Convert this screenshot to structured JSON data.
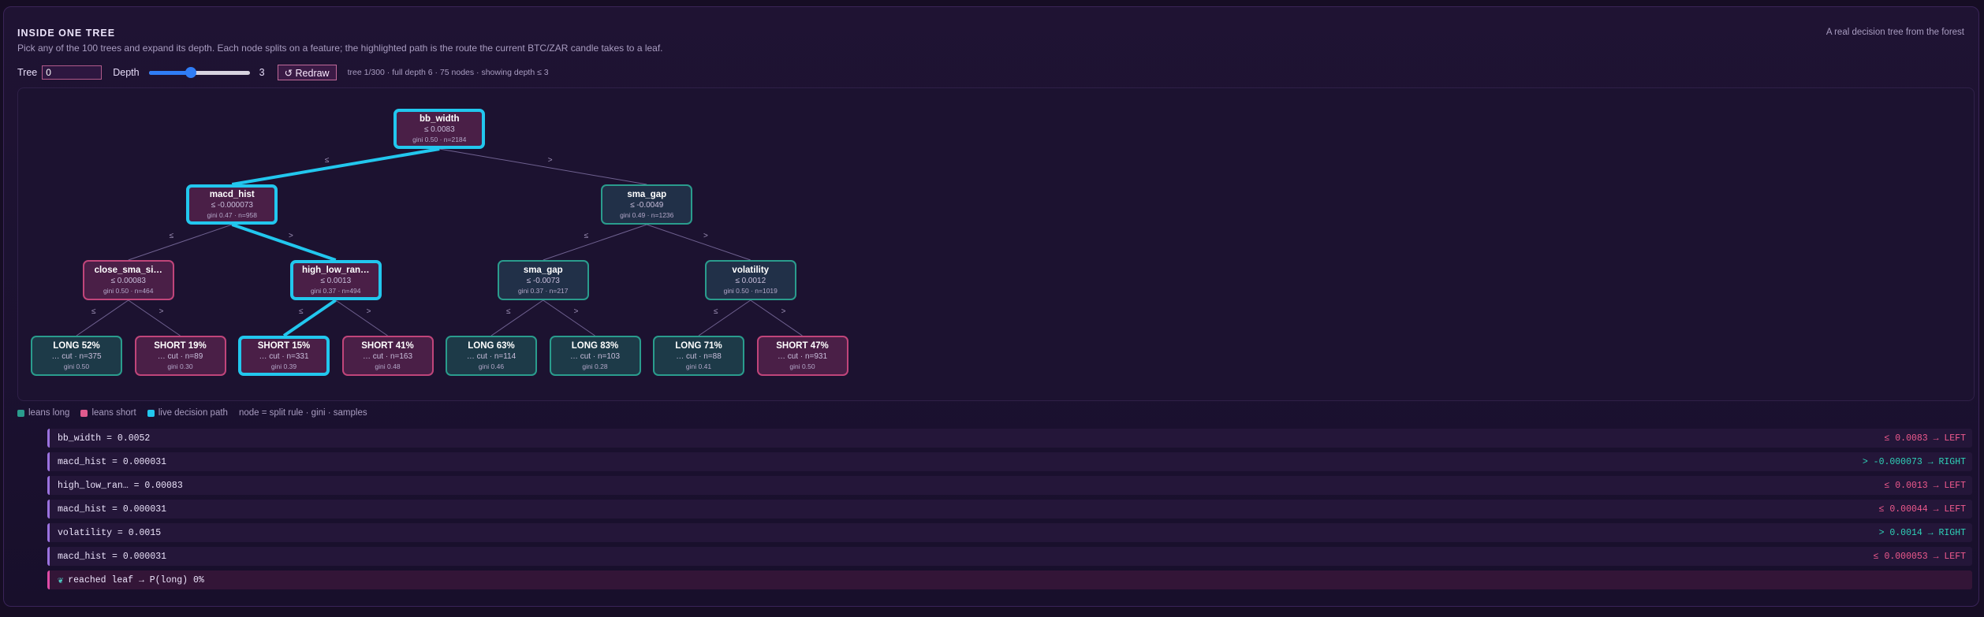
{
  "header": {
    "title": "INSIDE ONE TREE",
    "subtitle": "Pick any of the 100 trees and expand its depth. Each node splits on a feature; the highlighted path is the route the current BTC/ZAR candle takes to a leaf.",
    "right_note": "A real decision tree from the forest"
  },
  "controls": {
    "tree_label": "Tree",
    "tree_value": "0",
    "depth_label": "Depth",
    "depth_value": "3",
    "depth_fraction": 0.42,
    "redraw_label": "↺ Redraw",
    "info": "tree 1/300 · full depth 6 · 75 nodes · showing depth ≤ 3"
  },
  "colors": {
    "long": "#2a9c8d",
    "short": "#c0457a",
    "path": "#22c7ee",
    "edge": "#6f6190"
  },
  "tree": {
    "nodes": [
      {
        "title": "bb_width",
        "rule": "≤ 0.0083",
        "stats": "gini 0.50 · n=2184",
        "lean": "short",
        "path": true
      },
      {
        "title": "macd_hist",
        "rule": "≤ -0.000073",
        "stats": "gini 0.47 · n=958",
        "lean": "short",
        "path": true
      },
      {
        "title": "sma_gap",
        "rule": "≤ -0.0049",
        "stats": "gini 0.49 · n=1236",
        "lean": "long",
        "path": false
      },
      {
        "title": "close_sma_si…",
        "rule": "≤ 0.00083",
        "stats": "gini 0.50 · n=464",
        "lean": "short",
        "path": false
      },
      {
        "title": "high_low_ran…",
        "rule": "≤ 0.0013",
        "stats": "gini 0.37 · n=494",
        "lean": "short",
        "path": true
      },
      {
        "title": "sma_gap",
        "rule": "≤ -0.0073",
        "stats": "gini 0.37 · n=217",
        "lean": "long",
        "path": false
      },
      {
        "title": "volatility",
        "rule": "≤ 0.0012",
        "stats": "gini 0.50 · n=1019",
        "lean": "long",
        "path": false
      },
      {
        "title": "LONG 52%",
        "rule": "… cut · n=375",
        "stats": "gini 0.50",
        "lean": "long",
        "path": false
      },
      {
        "title": "SHORT 19%",
        "rule": "… cut · n=89",
        "stats": "gini 0.30",
        "lean": "short",
        "path": false
      },
      {
        "title": "SHORT 15%",
        "rule": "… cut · n=331",
        "stats": "gini 0.39",
        "lean": "short",
        "path": true
      },
      {
        "title": "SHORT 41%",
        "rule": "… cut · n=163",
        "stats": "gini 0.48",
        "lean": "short",
        "path": false
      },
      {
        "title": "LONG 63%",
        "rule": "… cut · n=114",
        "stats": "gini 0.46",
        "lean": "long",
        "path": false
      },
      {
        "title": "LONG 83%",
        "rule": "… cut · n=103",
        "stats": "gini 0.28",
        "lean": "long",
        "path": false
      },
      {
        "title": "LONG 71%",
        "rule": "… cut · n=88",
        "stats": "gini 0.41",
        "lean": "long",
        "path": false
      },
      {
        "title": "SHORT 47%",
        "rule": "… cut · n=931",
        "stats": "gini 0.50",
        "lean": "short",
        "path": false
      }
    ],
    "edge_le": "≤",
    "edge_gt": ">"
  },
  "legend": {
    "long": "leans long",
    "short": "leans short",
    "path": "live decision path",
    "note": "node = split rule · gini · samples"
  },
  "steps": [
    {
      "feature": "bb_width = 0.0052",
      "decision": "≤ 0.0083 → LEFT",
      "dir": "left"
    },
    {
      "feature": "macd_hist = 0.000031",
      "decision": "> -0.000073 → RIGHT",
      "dir": "right"
    },
    {
      "feature": "high_low_ran… = 0.00083",
      "decision": "≤ 0.0013 → LEFT",
      "dir": "left"
    },
    {
      "feature": "macd_hist = 0.000031",
      "decision": "≤ 0.00044 → LEFT",
      "dir": "left"
    },
    {
      "feature": "volatility = 0.0015",
      "decision": "> 0.0014 → RIGHT",
      "dir": "right"
    },
    {
      "feature": "macd_hist = 0.000031",
      "decision": "≤ 0.000053 → LEFT",
      "dir": "left"
    }
  ],
  "leaf_result": "reached leaf → P(long) 0%"
}
